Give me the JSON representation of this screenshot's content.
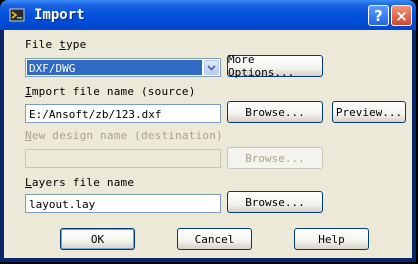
{
  "window": {
    "title": "Import",
    "help_button": "?",
    "close_button": "×"
  },
  "file_type": {
    "label_prefix": "File ",
    "label_accel": "t",
    "label_suffix": "ype",
    "value": "DXF/DWG",
    "more_options": "More Options..."
  },
  "import_name": {
    "label_accel": "I",
    "label_rest": "mport file name (source)",
    "value": "E:/Ansoft/zb/123.dxf",
    "browse": "Browse...",
    "preview": "Preview..."
  },
  "design_name": {
    "label_accel": "N",
    "label_rest": "ew design name (destination)",
    "value": "",
    "browse": "Browse..."
  },
  "layers": {
    "label_accel": "L",
    "label_rest": "ayers file name",
    "value": "layout.lay",
    "browse": "Browse..."
  },
  "buttons": {
    "ok": "OK",
    "cancel": "Cancel",
    "help": "Help"
  },
  "colors": {
    "titlebar": "#0050dc",
    "face": "#ece9d8",
    "selection": "#316ac5"
  }
}
